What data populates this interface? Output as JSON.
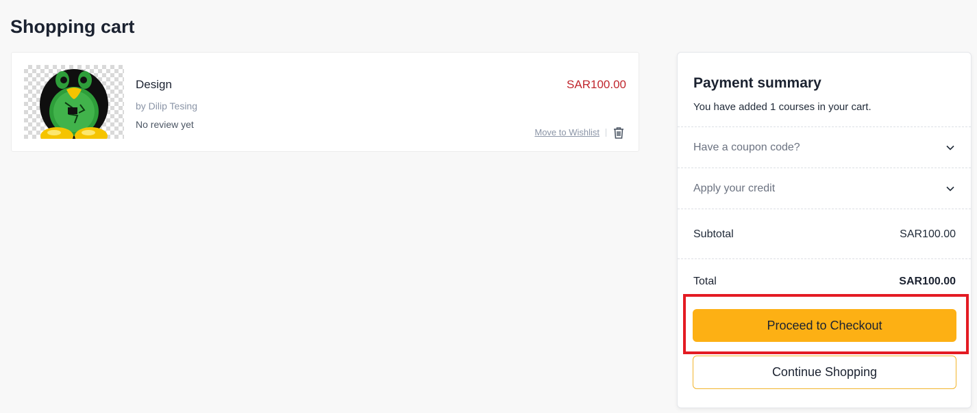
{
  "page": {
    "title": "Shopping cart"
  },
  "cart": {
    "items": [
      {
        "title": "Design",
        "author": "by Dilip Tesing",
        "review": "No review yet",
        "price": "SAR100.00",
        "wishlist_label": "Move to Wishlist",
        "thumbnail_icon": "tux-penguin-image",
        "delete_icon": "trash-icon"
      }
    ]
  },
  "summary": {
    "title": "Payment summary",
    "subtitle": "You have added 1 courses in your cart.",
    "coupon_label": "Have a coupon code?",
    "credit_label": "Apply your credit",
    "subtotal_label": "Subtotal",
    "subtotal_value": "SAR100.00",
    "total_label": "Total",
    "total_value": "SAR100.00",
    "checkout_label": "Proceed to Checkout",
    "continue_label": "Continue Shopping"
  },
  "colors": {
    "accent": "#fdb014",
    "price": "#c0262d",
    "highlight": "#e31b23"
  }
}
